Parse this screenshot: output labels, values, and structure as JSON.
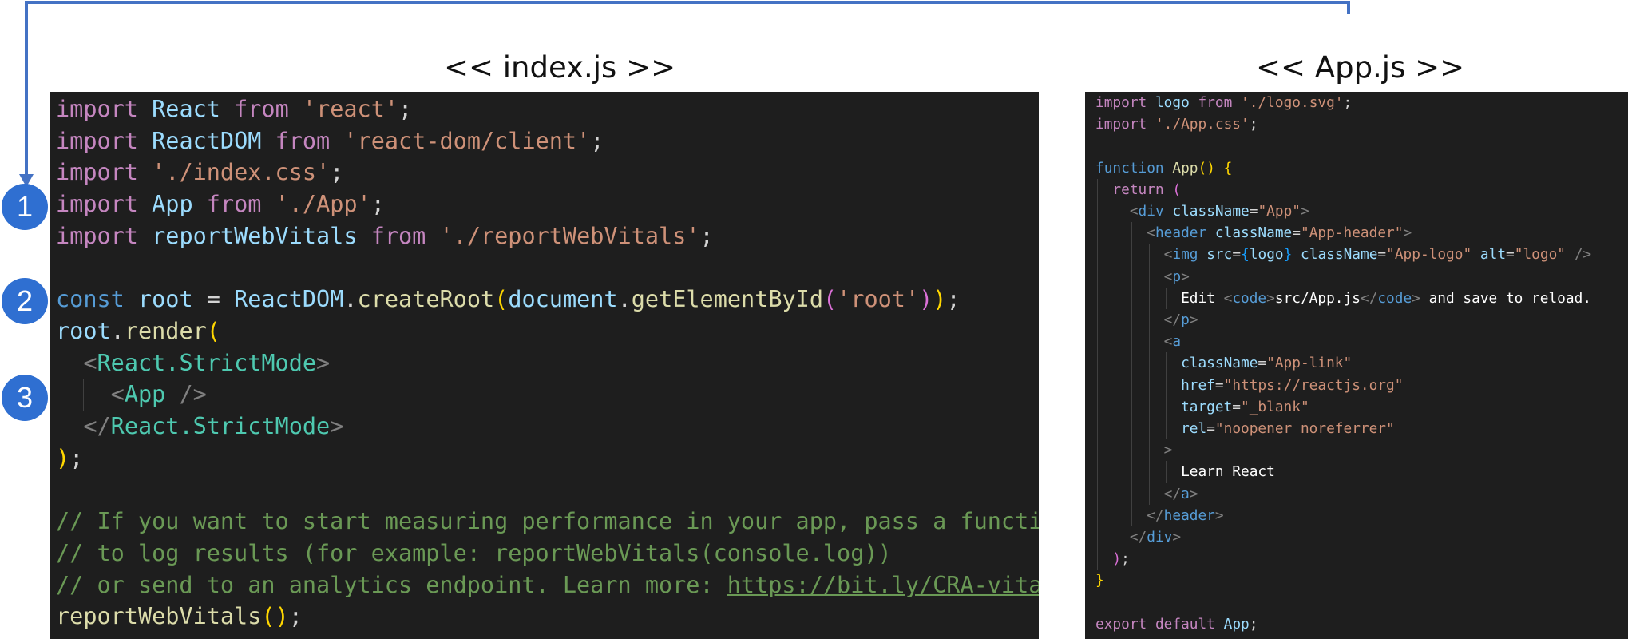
{
  "titles": {
    "index": "<< index.js >>",
    "app": "<< App.js >>"
  },
  "markers": [
    "1",
    "2",
    "3"
  ],
  "colors": {
    "arrow": "#4472c4",
    "marker_fill": "#2f6fd1",
    "editor_bg": "#1e1e1e"
  },
  "index_code": {
    "l1": [
      "import",
      " ",
      "React",
      " ",
      "from",
      " ",
      "'react'",
      ";"
    ],
    "l2": [
      "import",
      " ",
      "ReactDOM",
      " ",
      "from",
      " ",
      "'react-dom/client'",
      ";"
    ],
    "l3": [
      "import",
      " ",
      "'./index.css'",
      ";"
    ],
    "l4": [
      "import",
      " ",
      "App",
      " ",
      "from",
      " ",
      "'./App'",
      ";"
    ],
    "l5": [
      "import",
      " ",
      "reportWebVitals",
      " ",
      "from",
      " ",
      "'./reportWebVitals'",
      ";"
    ],
    "l7": [
      "const",
      " ",
      "root",
      " = ",
      "ReactDOM",
      ".",
      "createRoot",
      "(",
      "document",
      ".",
      "getElementById",
      "(",
      "'root'",
      ")",
      ")",
      ";"
    ],
    "l8": [
      "root",
      ".",
      "render",
      "("
    ],
    "l9": [
      "<",
      "React.StrictMode",
      ">"
    ],
    "l10": [
      "<",
      "App",
      " />"
    ],
    "l11": [
      "</",
      "React.StrictMode",
      ">"
    ],
    "l12": [
      ")",
      ";"
    ],
    "l14": "// If you want to start measuring performance in your app, pass a function",
    "l15": "// to log results (for example: reportWebVitals(console.log))",
    "l16": [
      "// or send to an analytics endpoint. Learn more: ",
      "https://bit.ly/CRA-vitals"
    ],
    "l17": [
      "reportWebVitals",
      "(",
      ")",
      ";"
    ]
  },
  "app_code": {
    "l1": [
      "import",
      " ",
      "logo",
      " ",
      "from",
      " ",
      "'./logo.svg'",
      ";"
    ],
    "l2": [
      "import",
      " ",
      "'./App.css'",
      ";"
    ],
    "l4": [
      "function",
      " ",
      "App",
      "(",
      ")",
      " ",
      "{"
    ],
    "l5": [
      "return",
      " ",
      "("
    ],
    "l6": [
      "<",
      "div",
      " ",
      "className",
      "=",
      "\"App\"",
      ">"
    ],
    "l7": [
      "<",
      "header",
      " ",
      "className",
      "=",
      "\"App-header\"",
      ">"
    ],
    "l8": [
      "<",
      "img",
      " ",
      "src",
      "=",
      "{",
      "logo",
      "}",
      " ",
      "className",
      "=",
      "\"App-logo\"",
      " ",
      "alt",
      "=",
      "\"logo\"",
      " />"
    ],
    "l9": [
      "<",
      "p",
      ">"
    ],
    "l10": [
      "Edit ",
      "<",
      "code",
      ">",
      "src/App.js",
      "</",
      "code",
      ">",
      " and save to reload."
    ],
    "l11": [
      "</",
      "p",
      ">"
    ],
    "l12": [
      "<",
      "a"
    ],
    "l13": [
      "className",
      "=",
      "\"App-link\""
    ],
    "l14": [
      "href",
      "=",
      "\"",
      "https://reactjs.org",
      "\""
    ],
    "l15": [
      "target",
      "=",
      "\"_blank\""
    ],
    "l16": [
      "rel",
      "=",
      "\"noopener noreferrer\""
    ],
    "l17": [
      ">"
    ],
    "l18": [
      "Learn React"
    ],
    "l19": [
      "</",
      "a",
      ">"
    ],
    "l20": [
      "</",
      "header",
      ">"
    ],
    "l21": [
      "</",
      "div",
      ">"
    ],
    "l22": [
      ")",
      ";"
    ],
    "l23": [
      "}"
    ],
    "l25": [
      "export",
      " ",
      "default",
      " ",
      "App",
      ";"
    ]
  }
}
